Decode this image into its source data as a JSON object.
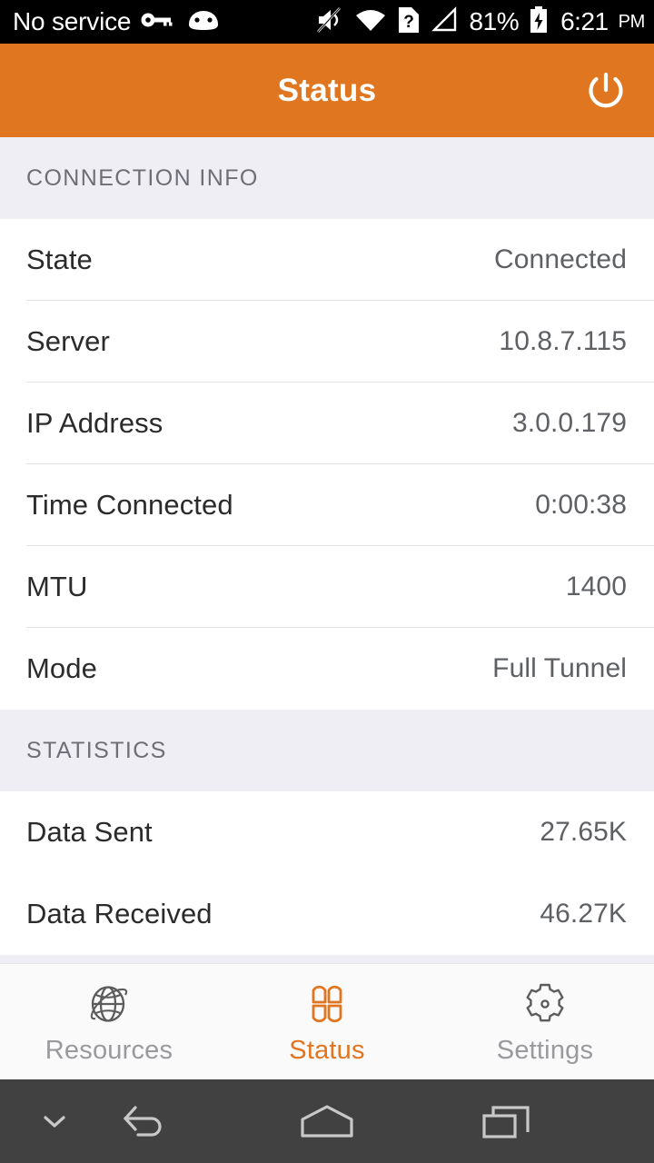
{
  "system_status_bar": {
    "carrier": "No service",
    "battery_percent": "81%",
    "time": "6:21",
    "am_pm": "PM",
    "icons": [
      "vpn-key-icon",
      "android-robot-icon",
      "volume-muted-icon",
      "wifi-icon",
      "sim-missing-icon",
      "cell-signal-icon",
      "battery-charging-icon"
    ]
  },
  "toolbar": {
    "title": "Status",
    "power_icon": "power-icon",
    "background_color": "#E0761F"
  },
  "sections": [
    {
      "header": "CONNECTION INFO",
      "rows": [
        {
          "label": "State",
          "value": "Connected",
          "divider": true
        },
        {
          "label": "Server",
          "value": "10.8.7.115",
          "divider": true
        },
        {
          "label": "IP Address",
          "value": "3.0.0.179",
          "divider": true
        },
        {
          "label": "Time Connected",
          "value": "0:00:38",
          "divider": true
        },
        {
          "label": "MTU",
          "value": "1400",
          "divider": true
        },
        {
          "label": "Mode",
          "value": "Full Tunnel",
          "divider": false
        }
      ]
    },
    {
      "header": "STATISTICS",
      "rows": [
        {
          "label": "Data Sent",
          "value": "27.65K",
          "divider": false
        },
        {
          "label": "Data Received",
          "value": "46.27K",
          "divider": false
        }
      ]
    }
  ],
  "tabbar": {
    "active": "Status",
    "active_color": "#E0761F",
    "inactive_color": "#9A9A9E",
    "tabs": [
      {
        "label": "Resources",
        "icon": "globe-icon",
        "active": false
      },
      {
        "label": "Status",
        "icon": "clover-icon",
        "active": true
      },
      {
        "label": "Settings",
        "icon": "gear-icon",
        "active": false
      }
    ]
  },
  "navigation_bar": {
    "buttons": [
      {
        "name": "collapse-keyboard-icon"
      },
      {
        "name": "back-icon"
      },
      {
        "name": "home-icon"
      },
      {
        "name": "recents-icon"
      }
    ]
  }
}
